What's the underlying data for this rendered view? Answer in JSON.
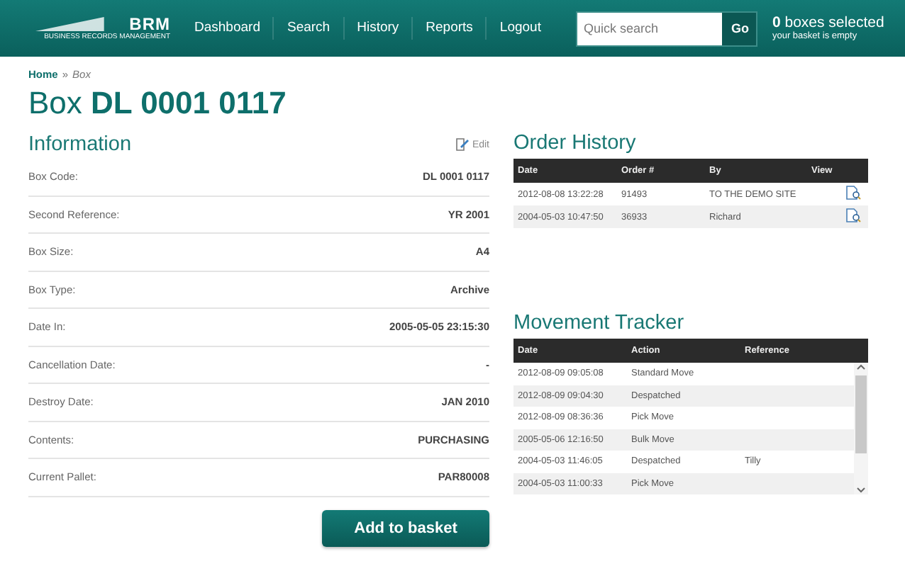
{
  "header": {
    "logo": {
      "name": "BRM",
      "tagline": "BUSINESS RECORDS MANAGEMENT"
    },
    "nav": [
      {
        "label": "Dashboard"
      },
      {
        "label": "Search"
      },
      {
        "label": "History"
      },
      {
        "label": "Reports"
      },
      {
        "label": "Logout"
      }
    ],
    "search": {
      "placeholder": "Quick search",
      "button": "Go"
    },
    "basket": {
      "summary": "**0** boxes selected",
      "note": "your basket is empty"
    }
  },
  "breadcrumb": [
    {
      "label": "Home",
      "kind": "link"
    },
    {
      "label": "»",
      "kind": "separator"
    },
    {
      "label": "Box",
      "kind": "current"
    }
  ],
  "title": "Box **DL 0001 0117**",
  "information": {
    "heading": "Information",
    "edit": "Edit",
    "fields": [
      {
        "label": "Box Code:",
        "value": "DL 0001 0117"
      },
      {
        "label": "Second Reference:",
        "value": "YR 2001"
      },
      {
        "label": "Box Size:",
        "value": "A4"
      },
      {
        "label": "Box Type:",
        "value": "Archive"
      },
      {
        "label": "Date In:",
        "value": "2005-05-05 23:15:30"
      },
      {
        "label": "Cancellation Date:",
        "value": "-"
      },
      {
        "label": "Destroy Date:",
        "value": "JAN 2010"
      },
      {
        "label": "Contents:",
        "value": "PURCHASING"
      },
      {
        "label": "Current Pallet:",
        "value": "PAR80008"
      }
    ],
    "button": "Add to basket"
  },
  "order_history": {
    "heading": "Order History",
    "columns": [
      "Date",
      "Order #",
      "By",
      "View"
    ],
    "rows": [
      {
        "date": "2012-08-08 13:22:28",
        "order": "91493",
        "by": "TO THE DEMO SITE"
      },
      {
        "date": "2004-05-03 10:47:50",
        "order": "36933",
        "by": "Richard"
      }
    ]
  },
  "movement_tracker": {
    "heading": "Movement Tracker",
    "columns": [
      "Date",
      "Action",
      "Reference"
    ],
    "rows": [
      {
        "date": "2012-08-09 09:05:08",
        "action": "Standard Move",
        "reference": ""
      },
      {
        "date": "2012-08-09 09:04:30",
        "action": "Despatched",
        "reference": ""
      },
      {
        "date": "2012-08-09 08:36:36",
        "action": "Pick Move",
        "reference": ""
      },
      {
        "date": "2005-05-06 12:16:50",
        "action": "Bulk Move",
        "reference": ""
      },
      {
        "date": "2004-05-03 11:46:05",
        "action": "Despatched",
        "reference": "Tilly"
      },
      {
        "date": "2004-05-03 11:00:33",
        "action": "Pick Move",
        "reference": ""
      }
    ]
  }
}
